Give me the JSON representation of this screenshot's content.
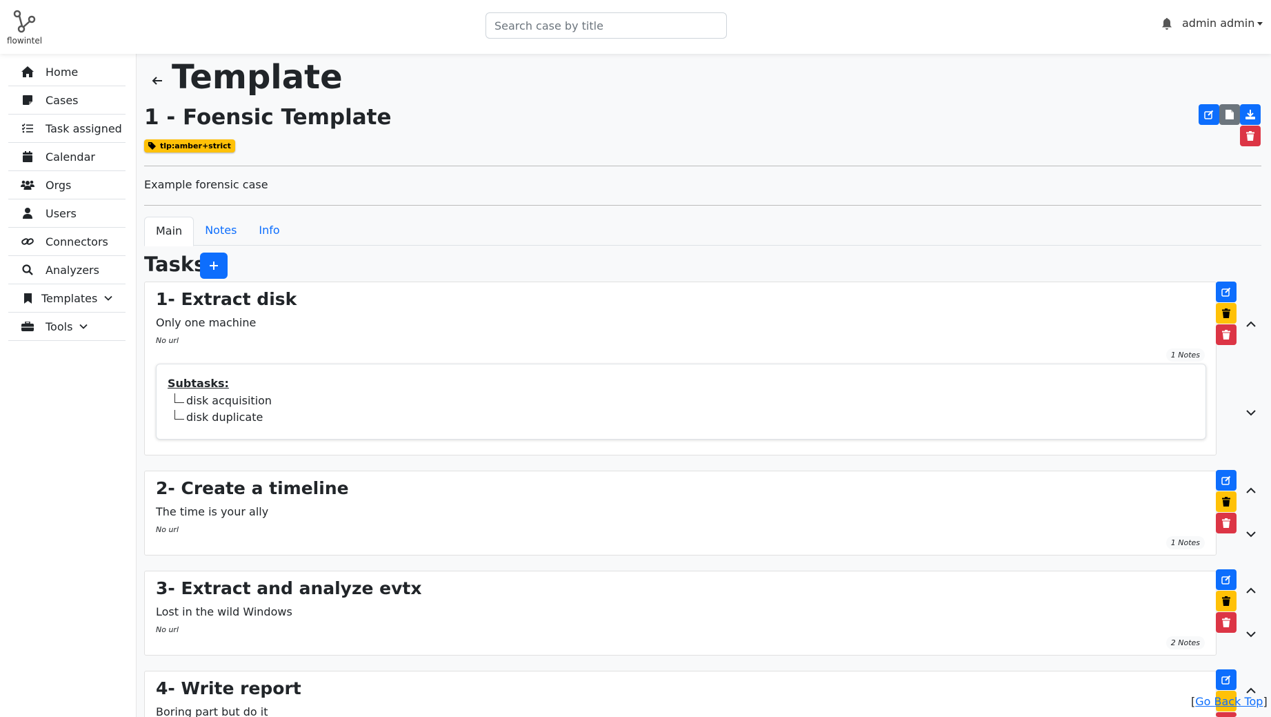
{
  "header": {
    "logo_text": "flowintel",
    "search_placeholder": "Search case by title",
    "user_name": "admin admin"
  },
  "sidebar": {
    "items": [
      {
        "label": "Home",
        "icon": "house-icon"
      },
      {
        "label": "Cases",
        "icon": "note-icon"
      },
      {
        "label": "Task assigned",
        "icon": "list-check-icon"
      },
      {
        "label": "Calendar",
        "icon": "calendar-icon"
      },
      {
        "label": "Orgs",
        "icon": "users-icon"
      },
      {
        "label": "Users",
        "icon": "user-icon"
      },
      {
        "label": "Connectors",
        "icon": "link-icon"
      },
      {
        "label": "Analyzers",
        "icon": "magnifier-icon"
      },
      {
        "label": "Templates",
        "icon": "bookmark-icon"
      },
      {
        "label": "Tools",
        "icon": "toolbox-icon"
      }
    ]
  },
  "page": {
    "title": "Template",
    "case_title": "1 - Foensic Template",
    "tag": "tlp:amber+strict",
    "description": "Example forensic case"
  },
  "tabs": [
    "Main",
    "Notes",
    "Info"
  ],
  "tasks_heading": "Tasks",
  "tasks": [
    {
      "title": "1- Extract disk",
      "description": "Only one machine",
      "url": "No url",
      "notes": "1 Notes",
      "subtasks_label": "Subtasks:",
      "subtasks": [
        "disk acquisition",
        "disk duplicate"
      ]
    },
    {
      "title": "2- Create a timeline",
      "description": "The time is your ally",
      "url": "No url",
      "notes": "1 Notes"
    },
    {
      "title": "3- Extract and analyze evtx",
      "description": "Lost in the wild Windows",
      "url": "No url",
      "notes": "2 Notes"
    },
    {
      "title": "4- Write report",
      "description": "Boring part but do it"
    }
  ],
  "footer": {
    "go_back_top": "Go Back Top",
    "bracket_open": "[",
    "bracket_close": "]"
  },
  "colors": {
    "primary": "#0d6efd",
    "warning": "#ffc107",
    "danger": "#dc3545",
    "secondary": "#6c757d"
  }
}
